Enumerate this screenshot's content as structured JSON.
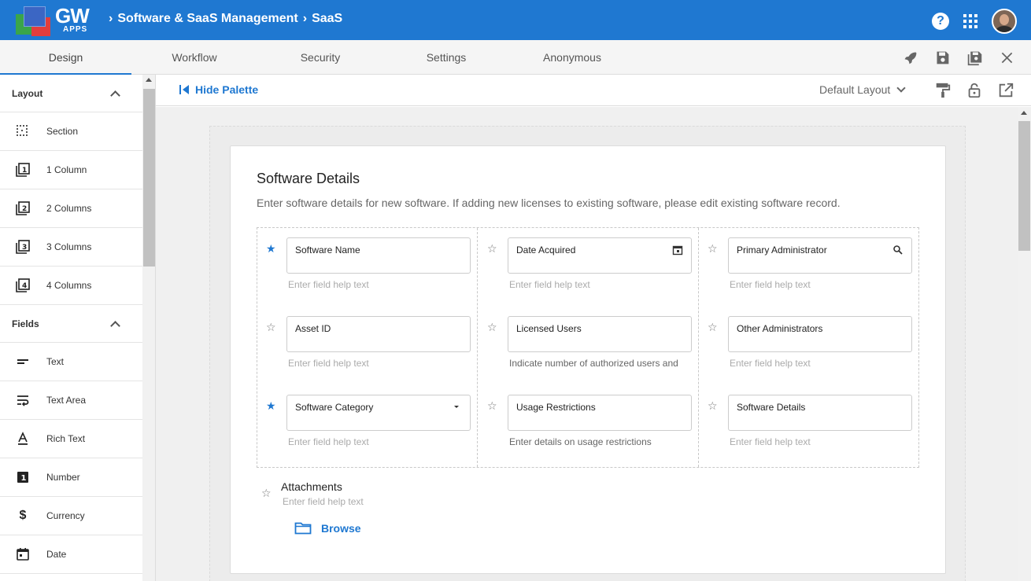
{
  "app": {
    "logo_text": "GW",
    "logo_sub": "APPS"
  },
  "breadcrumb": {
    "items": [
      "Software & SaaS Management",
      "SaaS"
    ]
  },
  "tabs": [
    "Design",
    "Workflow",
    "Security",
    "Settings",
    "Anonymous"
  ],
  "palette": {
    "hide_label": "Hide Palette",
    "sections": [
      {
        "title": "Layout",
        "items": [
          "Section",
          "1 Column",
          "2 Columns",
          "3 Columns",
          "4 Columns"
        ]
      },
      {
        "title": "Fields",
        "items": [
          "Text",
          "Text Area",
          "Rich Text",
          "Number",
          "Currency",
          "Date"
        ]
      }
    ]
  },
  "layout_select": {
    "value": "Default Layout"
  },
  "form": {
    "title": "Software Details",
    "description": "Enter software details for new software. If adding new licenses to existing software, please edit existing software record.",
    "fields": [
      {
        "label": "Software Name",
        "help": "Enter field help text",
        "required": true
      },
      {
        "label": "Date Acquired",
        "help": "Enter field help text",
        "required": false
      },
      {
        "label": "Primary Administrator",
        "help": "Enter field help text",
        "required": false
      },
      {
        "label": "Asset ID",
        "help": "Enter field help text",
        "required": false
      },
      {
        "label": "Licensed Users",
        "help": "Indicate number of authorized users and",
        "required": false
      },
      {
        "label": "Other Administrators",
        "help": "Enter field help text",
        "required": false
      },
      {
        "label": "Software Category",
        "help": "Enter field help text",
        "required": true
      },
      {
        "label": "Usage Restrictions",
        "help": "Enter details on usage restrictions",
        "required": false
      },
      {
        "label": "Software Details",
        "help": "Enter field help text",
        "required": false
      }
    ],
    "attachments": {
      "label": "Attachments",
      "help": "Enter field help text",
      "browse": "Browse"
    }
  },
  "colors": {
    "primary": "#1f78d1",
    "topbar": "#1f78d1"
  }
}
